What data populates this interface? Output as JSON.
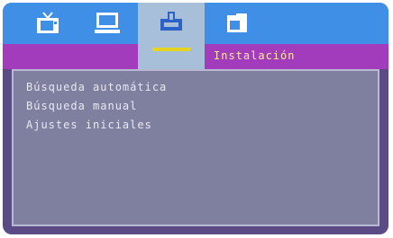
{
  "tabs": [
    {
      "id": "tv",
      "icon": "tv-icon"
    },
    {
      "id": "pc",
      "icon": "monitor-icon"
    },
    {
      "id": "install",
      "icon": "installation-icon",
      "selected": true
    },
    {
      "id": "media",
      "icon": "media-icon"
    }
  ],
  "header": {
    "section_title": "Instalación"
  },
  "menu": {
    "items": [
      {
        "label": "Búsqueda automática"
      },
      {
        "label": "Búsqueda manual"
      },
      {
        "label": "Ajustes iniciales"
      }
    ]
  },
  "colors": {
    "tabbar": "#3f8fe6",
    "selected_tab": "#a8bfd9",
    "selected_underline": "#e5d422",
    "subbar": "#a23cbd",
    "panel": "#7f7fa0",
    "frame": "#5a4b86",
    "title_text": "#ffe8a0",
    "menu_text": "#e9e9f2"
  }
}
